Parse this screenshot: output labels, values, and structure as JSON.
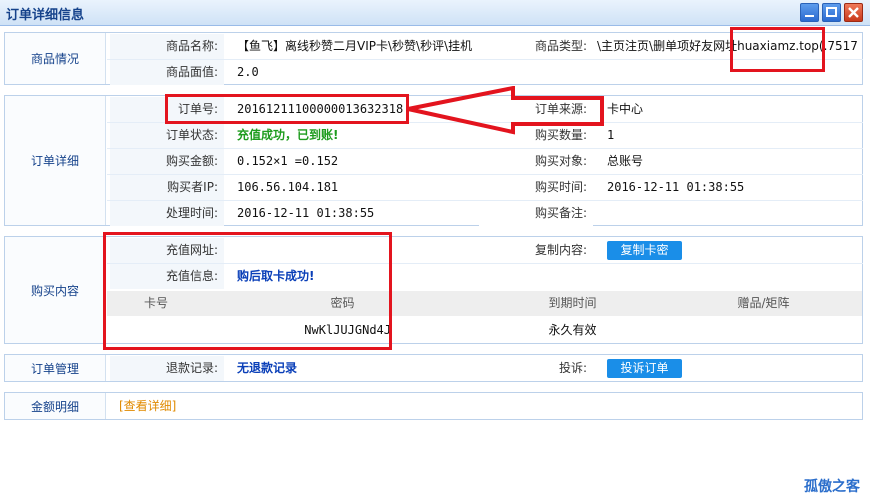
{
  "window": {
    "title": "订单详细信息"
  },
  "product": {
    "heading": "商品情况",
    "name_label": "商品名称:",
    "name_value": "【鱼飞】离线秒赞二月VIP卡\\秒赞\\秒评\\挂机",
    "type_label": "商品类型:",
    "type_value": "\\主页注页\\删单项好友网址huaxiamz.top(.7517",
    "price_label": "商品面值:",
    "price_value": "2.0"
  },
  "order": {
    "heading": "订单详细",
    "order_no_label": "订单号:",
    "order_no_value": "20161211100000013632318",
    "source_label": "订单来源:",
    "source_value": "卡中心",
    "status_label": "订单状态:",
    "status_value": "充值成功，已到账!",
    "qty_label": "购买数量:",
    "qty_value": "1",
    "amount_label": "购买金额:",
    "amount_value": "0.152×1 =0.152",
    "target_label": "购买对象:",
    "target_value": "总账号",
    "ip_label": "购买者IP:",
    "ip_value": "106.56.104.181",
    "time_label": "购买时间:",
    "time_value": "2016-12-11 01:38:55",
    "proc_label": "处理时间:",
    "proc_value": "2016-12-11 01:38:55",
    "note_label": "购买备注:",
    "note_value": ""
  },
  "purchase": {
    "heading": "购买内容",
    "url_label": "充值网址:",
    "url_value": "",
    "copy_label": "复制内容:",
    "copy_button": "复制卡密",
    "info_label": "充值信息:",
    "info_value": "购后取卡成功!",
    "columns": [
      "卡号",
      "密码",
      "到期时间",
      "赠品/矩阵"
    ],
    "rows": [
      {
        "card": "",
        "password": "NwKlJUJGNd4J",
        "expire": "永久有效",
        "gift": ""
      }
    ]
  },
  "manage": {
    "heading": "订单管理",
    "refund_label": "退款记录:",
    "refund_value": "无退款记录",
    "complaint_label": "投诉:",
    "complaint_button": "投诉订单"
  },
  "amount": {
    "heading": "金额明细",
    "link": "[查看详细]"
  },
  "watermark": "孤傲之客",
  "colors": {
    "annotation": "#e3141e",
    "accent_button": "#1a8ee8",
    "success": "#1e9c1e",
    "info": "#0a3fb8"
  }
}
